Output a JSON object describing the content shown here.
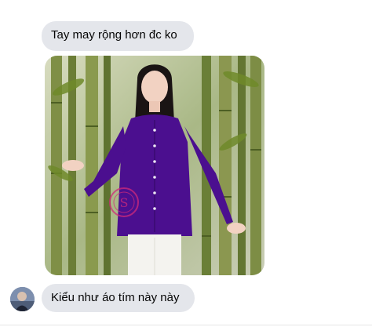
{
  "conversation": {
    "messages": [
      {
        "text": "Tay may rộng hơn đc ko",
        "type": "text"
      },
      {
        "type": "image",
        "watermark_text": "S"
      },
      {
        "text": "Kiểu như áo tím này này",
        "type": "text"
      }
    ],
    "sender_avatar_icon": "user-avatar-icon"
  },
  "colors": {
    "bubble_bg": "#e4e6eb",
    "bubble_text": "#050505",
    "shirt": "#4b0f8f",
    "pants": "#f4f3ef",
    "bamboo": "#5f7a2a"
  }
}
